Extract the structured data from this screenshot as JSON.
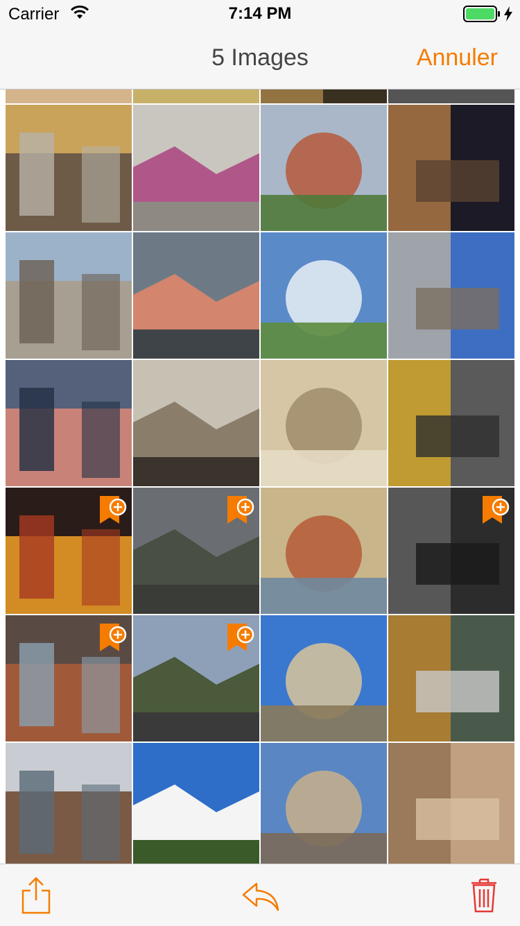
{
  "status_bar": {
    "carrier": "Carrier",
    "time": "7:14 PM",
    "icons": [
      "wifi-icon",
      "battery-icon",
      "charging-bolt-icon"
    ],
    "battery_color": "#4cd964"
  },
  "nav": {
    "title": "5 Images",
    "cancel_label": "Annuler"
  },
  "accent_color": "#f57c00",
  "toolbar": {
    "buttons": [
      "share-icon",
      "reply-icon",
      "trash-icon"
    ],
    "trash_color": "#e53935"
  },
  "grid": {
    "columns": 4,
    "selected_count": 5,
    "photos": [
      {
        "name": "photo-colmar-houses",
        "selected": false,
        "colors": [
          "#c9a35a",
          "#6d5b48",
          "#b8b2a6"
        ]
      },
      {
        "name": "photo-graffiti-bird",
        "selected": false,
        "colors": [
          "#c9c6bf",
          "#b0578a",
          "#8e8a83"
        ]
      },
      {
        "name": "photo-town-river",
        "selected": false,
        "colors": [
          "#a9b7c9",
          "#b75a3c",
          "#4f7a3a"
        ]
      },
      {
        "name": "photo-night-plaza",
        "selected": false,
        "colors": [
          "#1c1a26",
          "#c98a4a",
          "#5a4232"
        ]
      },
      {
        "name": "photo-stone-rooftops",
        "selected": false,
        "colors": [
          "#9cb2c9",
          "#a79f92",
          "#6b5f54"
        ]
      },
      {
        "name": "photo-bridge-reflection",
        "selected": false,
        "colors": [
          "#6d7a86",
          "#d4856d",
          "#3f4448"
        ]
      },
      {
        "name": "photo-church-domes",
        "selected": false,
        "colors": [
          "#5b8ac8",
          "#e9eef5",
          "#5d8c3e"
        ]
      },
      {
        "name": "photo-corner-building",
        "selected": false,
        "colors": [
          "#3d6ec1",
          "#c9b9a0",
          "#7a6e60"
        ]
      },
      {
        "name": "photo-harbour-sunset",
        "selected": false,
        "colors": [
          "#55617a",
          "#c98278",
          "#223044"
        ]
      },
      {
        "name": "photo-modern-atrium",
        "selected": false,
        "colors": [
          "#c7c1b4",
          "#8a7d6a",
          "#3a342c"
        ]
      },
      {
        "name": "photo-stone-stairwell",
        "selected": false,
        "colors": [
          "#d6c6a6",
          "#a08c6a",
          "#e6dbc4"
        ]
      },
      {
        "name": "photo-yellow-taxi",
        "selected": false,
        "colors": [
          "#5a5a5a",
          "#e9b71f",
          "#2e2e2e"
        ]
      },
      {
        "name": "photo-spice-market",
        "selected": true,
        "colors": [
          "#2a1c18",
          "#d38b24",
          "#a83a22"
        ]
      },
      {
        "name": "photo-glass-buildings",
        "selected": true,
        "colors": [
          "#6a6e72",
          "#4a4f44",
          "#3a3c38"
        ]
      },
      {
        "name": "photo-street-art-wall",
        "selected": false,
        "colors": [
          "#c9b58a",
          "#b55a36",
          "#6f8aa0"
        ]
      },
      {
        "name": "photo-metal-sculpture",
        "selected": true,
        "colors": [
          "#2c2c2c",
          "#6a6a6a",
          "#1a1a1a"
        ]
      },
      {
        "name": "photo-love-locks",
        "selected": true,
        "colors": [
          "#5a4a44",
          "#a05a3a",
          "#8aa0b0"
        ]
      },
      {
        "name": "photo-valley-village",
        "selected": true,
        "colors": [
          "#8ea0b8",
          "#4a5a3a",
          "#3a3a3a"
        ]
      },
      {
        "name": "photo-ornate-facade",
        "selected": false,
        "colors": [
          "#3a78d0",
          "#d9c49a",
          "#8a7a5a"
        ]
      },
      {
        "name": "photo-food-stall",
        "selected": false,
        "colors": [
          "#4a5a4a",
          "#d08a2a",
          "#c8c8c8"
        ]
      },
      {
        "name": "photo-harbour-houses",
        "selected": false,
        "colors": [
          "#c9ccd2",
          "#7a5a44",
          "#5a6a78"
        ]
      },
      {
        "name": "photo-white-villa",
        "selected": false,
        "colors": [
          "#2e6ec8",
          "#f4f4f4",
          "#3a5a2a"
        ]
      },
      {
        "name": "photo-cathedral-spires",
        "selected": false,
        "colors": [
          "#5a86c4",
          "#c9b08a",
          "#7a6a5a"
        ]
      },
      {
        "name": "photo-mudejar-tower",
        "selected": false,
        "colors": [
          "#c0a080",
          "#8a6a4a",
          "#d8c0a0"
        ]
      }
    ],
    "partial_top_row": [
      {
        "name": "photo-partial-1",
        "colors": [
          "#9a7a5a",
          "#d4b48a"
        ]
      },
      {
        "name": "photo-partial-2",
        "colors": [
          "#2a2a2a",
          "#d8c070"
        ]
      },
      {
        "name": "photo-partial-3",
        "colors": [
          "#3a3020",
          "#b89050"
        ]
      },
      {
        "name": "photo-partial-4",
        "colors": [
          "#1a1a1a",
          "#555555"
        ]
      }
    ]
  }
}
